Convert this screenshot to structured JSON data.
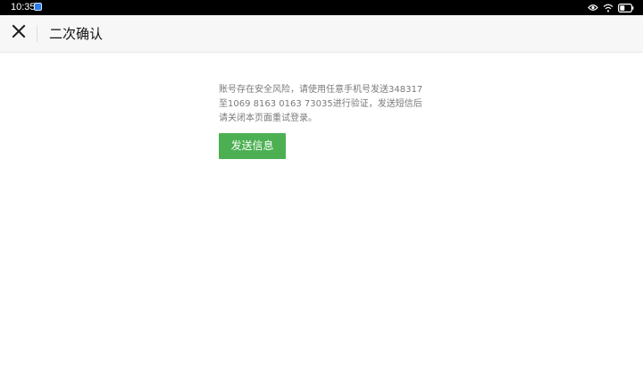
{
  "status_bar": {
    "time": "10:35",
    "icons": [
      "notification-icon",
      "eye-icon",
      "wifi-icon",
      "battery-icon"
    ]
  },
  "header": {
    "title": "二次确认",
    "close_icon": "close-icon"
  },
  "main": {
    "message": "账号存在安全风险，请使用任意手机号发送348317至1069 8163 0163 73035进行验证，发送短信后请关闭本页面重试登录。",
    "send_button": "发送信息"
  },
  "colors": {
    "accent": "#4cb052",
    "status_bar_bg": "#000000",
    "header_bg": "#f7f7f7",
    "message_text": "#7a7a7a"
  }
}
